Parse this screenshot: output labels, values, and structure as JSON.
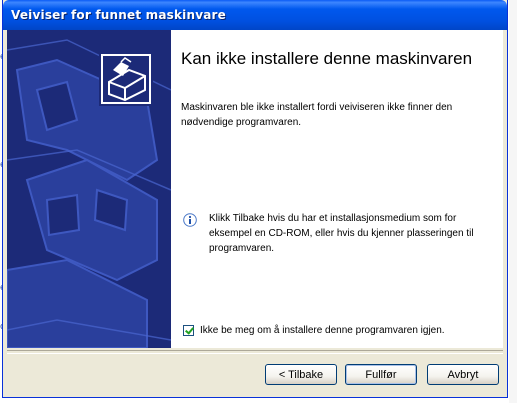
{
  "window": {
    "title": "Veiviser for funnet maskinvare"
  },
  "main": {
    "heading": "Kan ikke installere denne maskinvaren",
    "description": "Maskinvaren ble ikke installert fordi veiviseren ikke finner den nødvendige programvaren.",
    "info_text": "Klikk Tilbake hvis du har et installasjonsmedium som for eksempel en CD-ROM, eller hvis du kjenner plasseringen til programvaren.",
    "checkbox": {
      "label": "Ikke be meg om å installere denne programvaren igjen.",
      "checked": true
    }
  },
  "buttons": {
    "back": "< Tilbake",
    "finish": "Fullfør",
    "cancel": "Avbryt"
  },
  "colors": {
    "titlebar": "#0054e3",
    "left_panel": "#1c2a78",
    "dialog_bg": "#ece9d8"
  },
  "icons": {
    "info": "info-icon",
    "hardware": "hardware-box-icon",
    "checkbox_check": "check-icon"
  }
}
